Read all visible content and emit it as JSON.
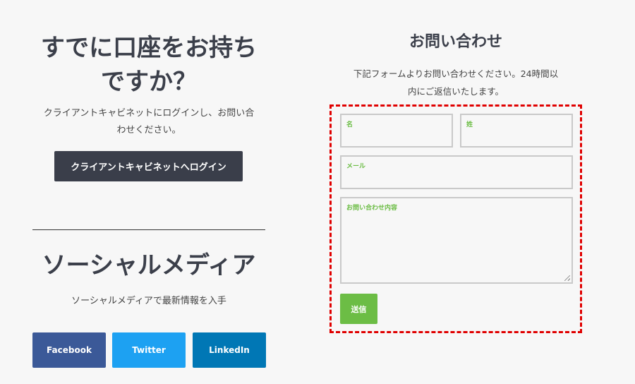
{
  "account": {
    "title_line1": "すでに口座をお持ち",
    "title_line2": "ですか？",
    "desc_line1": "クライアントキャビネットにログインし、お問い合",
    "desc_line2": "わせください。",
    "login_button": "クライアントキャビネットへログイン"
  },
  "social": {
    "title": "ソーシャルメディア",
    "desc": "ソーシャルメディアで最新情報を入手",
    "buttons": [
      {
        "label": "Facebook",
        "color": "#3b5998"
      },
      {
        "label": "Twitter",
        "color": "#1da1f2"
      },
      {
        "label": "LinkedIn",
        "color": "#0077b5"
      }
    ]
  },
  "contact": {
    "title": "お問い合わせ",
    "desc_line1": "下記フォームよりお問い合わせください。24時間以",
    "desc_line2": "内にご返信いたします。",
    "fields": {
      "first_name": "名",
      "last_name": "姓",
      "email": "メール",
      "message": "お問い合わせ内容"
    },
    "submit": "送信",
    "highlight_color": "#e00000",
    "accent_color": "#6cbd45"
  }
}
